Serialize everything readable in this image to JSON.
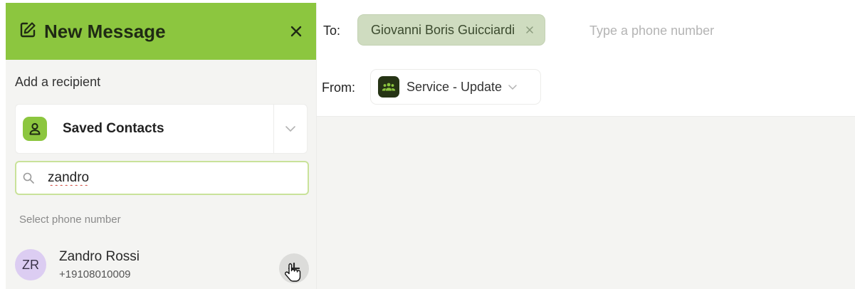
{
  "panel": {
    "title": "New Message",
    "add_recipient_label": "Add a recipient",
    "contacts_selector": {
      "label": "Saved Contacts"
    },
    "search": {
      "value": "zandro",
      "placeholder": ""
    },
    "phone_section_label": "Select phone number",
    "results": [
      {
        "initials": "ZR",
        "name": "Zandro Rossi",
        "number": "+19108010009"
      }
    ]
  },
  "compose": {
    "to_label": "To:",
    "recipients": [
      {
        "name": "Giovanni Boris Guicciardi"
      }
    ],
    "phone_placeholder": "Type a phone number",
    "from_label": "From:",
    "sender": "Service - Update"
  },
  "colors": {
    "accent_green": "#8cc63f",
    "chip_background": "#cfdcc0",
    "avatar_lilac": "#dccdf2",
    "sender_badge": "#263415"
  },
  "icons": [
    "compose-icon",
    "close-icon",
    "person-icon",
    "chevron-down-icon",
    "search-icon",
    "plus-icon",
    "cursor-icon",
    "group-icon",
    "remove-icon"
  ]
}
